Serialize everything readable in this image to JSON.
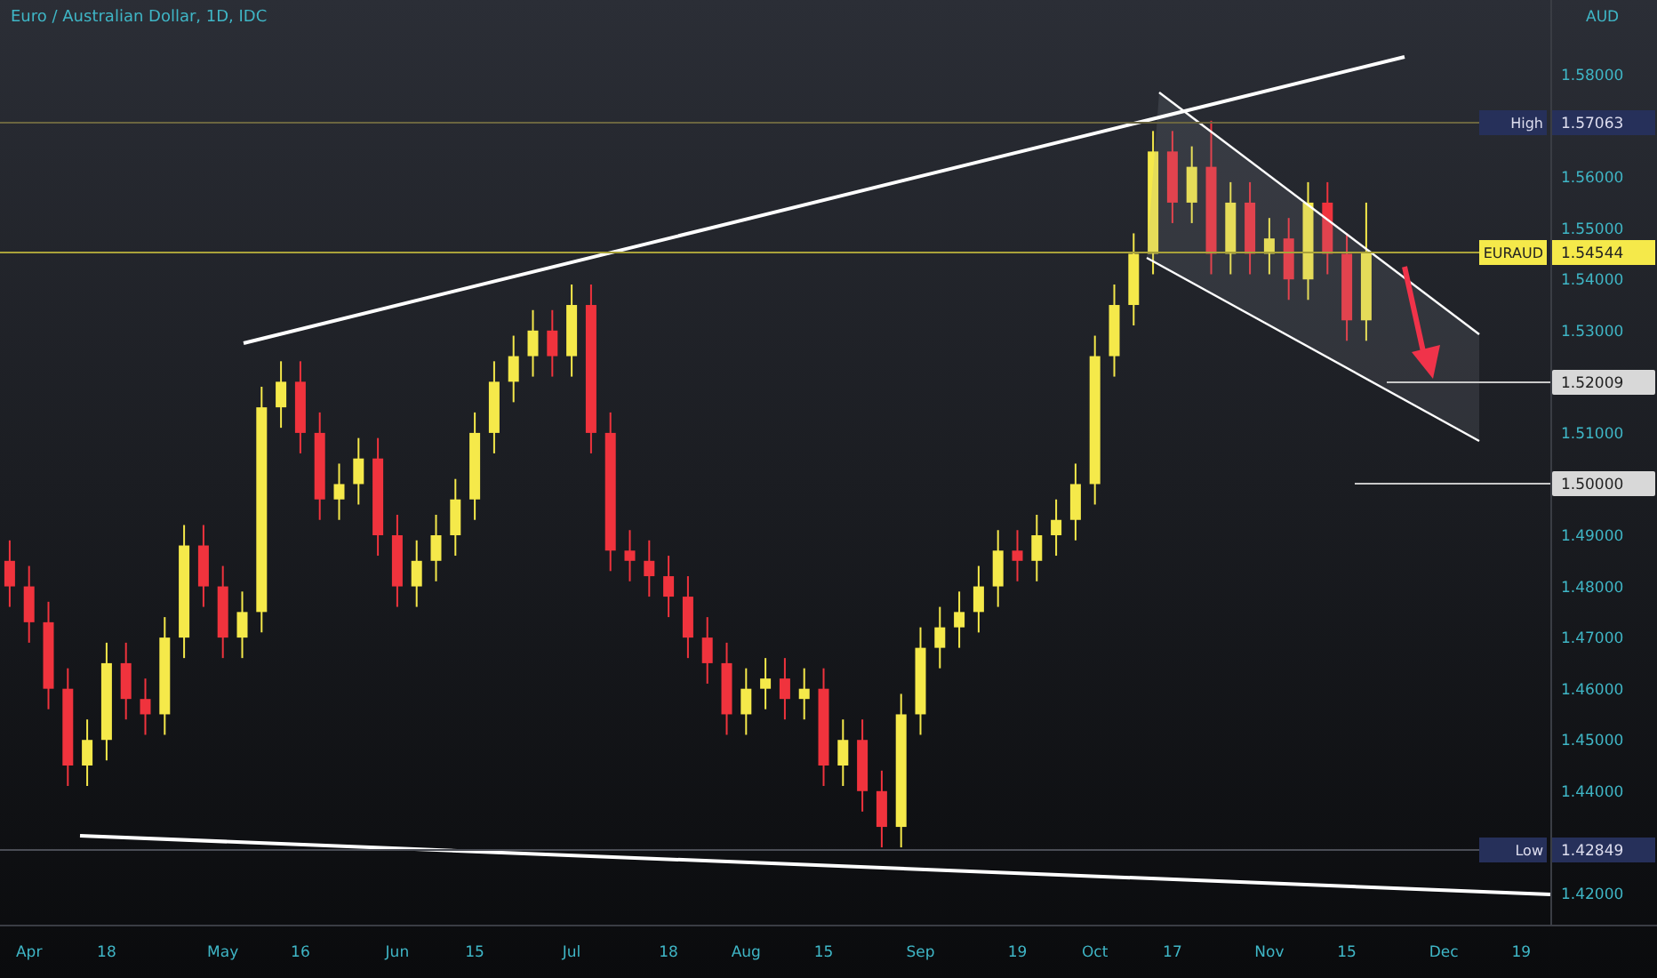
{
  "chart": {
    "price_tags": [
      {
        "name": "High",
        "kind": "high",
        "label": "1.57063"
      },
      {
        "name": "EURAUD",
        "kind": "last",
        "label": "1.54544"
      },
      {
        "kind": "level",
        "label": "1.52009"
      },
      {
        "kind": "level",
        "label": "1.50000"
      },
      {
        "name": "Low",
        "kind": "low",
        "label": "1.42849"
      }
    ],
    "chart_data": {
      "type": "candlestick",
      "title": "Euro / Australian Dollar, 1D, IDC",
      "ylabel": "AUD",
      "categories": [
        null,
        "Apr",
        null,
        null,
        null,
        "18",
        null,
        null,
        null,
        null,
        null,
        "May",
        null,
        null,
        null,
        "16",
        null,
        null,
        null,
        null,
        "Jun",
        null,
        null,
        null,
        "15",
        null,
        null,
        null,
        null,
        "Jul",
        null,
        null,
        null,
        null,
        "18",
        null,
        null,
        null,
        "Aug",
        null,
        null,
        null,
        "15",
        null,
        null,
        null,
        null,
        "Sep",
        null,
        null,
        null,
        null,
        "19",
        null,
        null,
        null,
        "Oct",
        null,
        null,
        null,
        "17",
        null,
        null,
        null,
        null,
        "Nov",
        null,
        null,
        null,
        "15",
        null,
        null,
        null,
        null,
        "Dec",
        null,
        null,
        null,
        "19",
        null
      ],
      "ohlc": [
        [
          1.485,
          1.489,
          1.476,
          1.48
        ],
        [
          1.48,
          1.484,
          1.469,
          1.473
        ],
        [
          1.473,
          1.477,
          1.456,
          1.46
        ],
        [
          1.46,
          1.464,
          1.441,
          1.445
        ],
        [
          1.445,
          1.454,
          1.441,
          1.45
        ],
        [
          1.45,
          1.469,
          1.446,
          1.465
        ],
        [
          1.465,
          1.469,
          1.454,
          1.458
        ],
        [
          1.458,
          1.462,
          1.451,
          1.455
        ],
        [
          1.455,
          1.474,
          1.451,
          1.47
        ],
        [
          1.47,
          1.492,
          1.466,
          1.488
        ],
        [
          1.488,
          1.492,
          1.476,
          1.48
        ],
        [
          1.48,
          1.484,
          1.466,
          1.47
        ],
        [
          1.47,
          1.479,
          1.466,
          1.475
        ],
        [
          1.475,
          1.519,
          1.471,
          1.515
        ],
        [
          1.515,
          1.524,
          1.511,
          1.52
        ],
        [
          1.52,
          1.524,
          1.506,
          1.51
        ],
        [
          1.51,
          1.514,
          1.493,
          1.497
        ],
        [
          1.497,
          1.504,
          1.493,
          1.5
        ],
        [
          1.5,
          1.509,
          1.496,
          1.505
        ],
        [
          1.505,
          1.509,
          1.486,
          1.49
        ],
        [
          1.49,
          1.494,
          1.476,
          1.48
        ],
        [
          1.48,
          1.489,
          1.476,
          1.485
        ],
        [
          1.485,
          1.494,
          1.481,
          1.49
        ],
        [
          1.49,
          1.501,
          1.486,
          1.497
        ],
        [
          1.497,
          1.514,
          1.493,
          1.51
        ],
        [
          1.51,
          1.524,
          1.506,
          1.52
        ],
        [
          1.52,
          1.529,
          1.516,
          1.525
        ],
        [
          1.525,
          1.534,
          1.521,
          1.53
        ],
        [
          1.53,
          1.534,
          1.521,
          1.525
        ],
        [
          1.525,
          1.539,
          1.521,
          1.535
        ],
        [
          1.535,
          1.539,
          1.506,
          1.51
        ],
        [
          1.51,
          1.514,
          1.483,
          1.487
        ],
        [
          1.487,
          1.491,
          1.481,
          1.485
        ],
        [
          1.485,
          1.489,
          1.478,
          1.482
        ],
        [
          1.482,
          1.486,
          1.474,
          1.478
        ],
        [
          1.478,
          1.482,
          1.466,
          1.47
        ],
        [
          1.47,
          1.474,
          1.461,
          1.465
        ],
        [
          1.465,
          1.469,
          1.451,
          1.455
        ],
        [
          1.455,
          1.464,
          1.451,
          1.46
        ],
        [
          1.46,
          1.466,
          1.456,
          1.462
        ],
        [
          1.462,
          1.466,
          1.454,
          1.458
        ],
        [
          1.458,
          1.464,
          1.454,
          1.46
        ],
        [
          1.46,
          1.464,
          1.441,
          1.445
        ],
        [
          1.445,
          1.454,
          1.441,
          1.45
        ],
        [
          1.45,
          1.454,
          1.436,
          1.44
        ],
        [
          1.44,
          1.444,
          1.429,
          1.433
        ],
        [
          1.433,
          1.459,
          1.429,
          1.455
        ],
        [
          1.455,
          1.472,
          1.451,
          1.468
        ],
        [
          1.468,
          1.476,
          1.464,
          1.472
        ],
        [
          1.472,
          1.479,
          1.468,
          1.475
        ],
        [
          1.475,
          1.484,
          1.471,
          1.48
        ],
        [
          1.48,
          1.491,
          1.476,
          1.487
        ],
        [
          1.487,
          1.491,
          1.481,
          1.485
        ],
        [
          1.485,
          1.494,
          1.481,
          1.49
        ],
        [
          1.49,
          1.497,
          1.486,
          1.493
        ],
        [
          1.493,
          1.504,
          1.489,
          1.5
        ],
        [
          1.5,
          1.529,
          1.496,
          1.525
        ],
        [
          1.525,
          1.539,
          1.521,
          1.535
        ],
        [
          1.535,
          1.549,
          1.531,
          1.545
        ],
        [
          1.545,
          1.569,
          1.541,
          1.565
        ],
        [
          1.565,
          1.569,
          1.551,
          1.555
        ],
        [
          1.555,
          1.566,
          1.551,
          1.562
        ],
        [
          1.562,
          1.571,
          1.541,
          1.545
        ],
        [
          1.545,
          1.559,
          1.541,
          1.555
        ],
        [
          1.555,
          1.559,
          1.541,
          1.545
        ],
        [
          1.545,
          1.552,
          1.541,
          1.548
        ],
        [
          1.548,
          1.552,
          1.536,
          1.54
        ],
        [
          1.54,
          1.559,
          1.536,
          1.555
        ],
        [
          1.555,
          1.559,
          1.541,
          1.545
        ],
        [
          1.545,
          1.549,
          1.528,
          1.532
        ],
        [
          1.532,
          1.555,
          1.528,
          1.5454
        ],
        null,
        null,
        null,
        null,
        null,
        null,
        null,
        null,
        null
      ],
      "ylim": [
        1.4139,
        1.5946
      ],
      "yticks": [
        {
          "value": 1.58,
          "label": "1.58000"
        },
        {
          "value": 1.56,
          "label": "1.56000"
        },
        {
          "value": 1.55,
          "label": "1.55000"
        },
        {
          "value": 1.54,
          "label": "1.54000"
        },
        {
          "value": 1.53,
          "label": "1.53000"
        },
        {
          "value": 1.51,
          "label": "1.51000"
        },
        {
          "value": 1.49,
          "label": "1.49000"
        },
        {
          "value": 1.48,
          "label": "1.48000"
        },
        {
          "value": 1.47,
          "label": "1.47000"
        },
        {
          "value": 1.46,
          "label": "1.46000"
        },
        {
          "value": 1.45,
          "label": "1.45000"
        },
        {
          "value": 1.44,
          "label": "1.44000"
        },
        {
          "value": 1.42,
          "label": "1.42000"
        }
      ]
    }
  }
}
